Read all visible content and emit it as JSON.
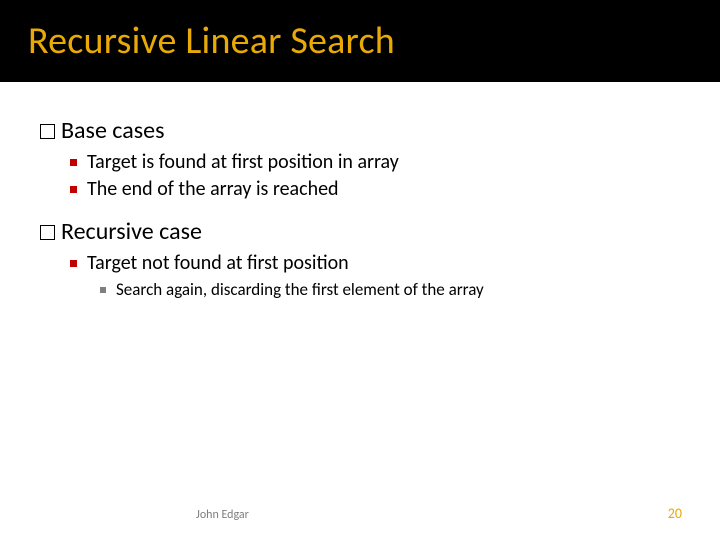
{
  "title": "Recursive Linear Search",
  "sections": [
    {
      "heading": "Base cases",
      "items": [
        {
          "text": "Target is found at first position in array",
          "sub": []
        },
        {
          "text": "The end of the array is reached",
          "sub": []
        }
      ]
    },
    {
      "heading": "Recursive case",
      "items": [
        {
          "text": "Target not found at first position",
          "sub": [
            "Search again, discarding the first element of the array"
          ]
        }
      ]
    }
  ],
  "footer": {
    "author": "John Edgar",
    "page": "20"
  }
}
